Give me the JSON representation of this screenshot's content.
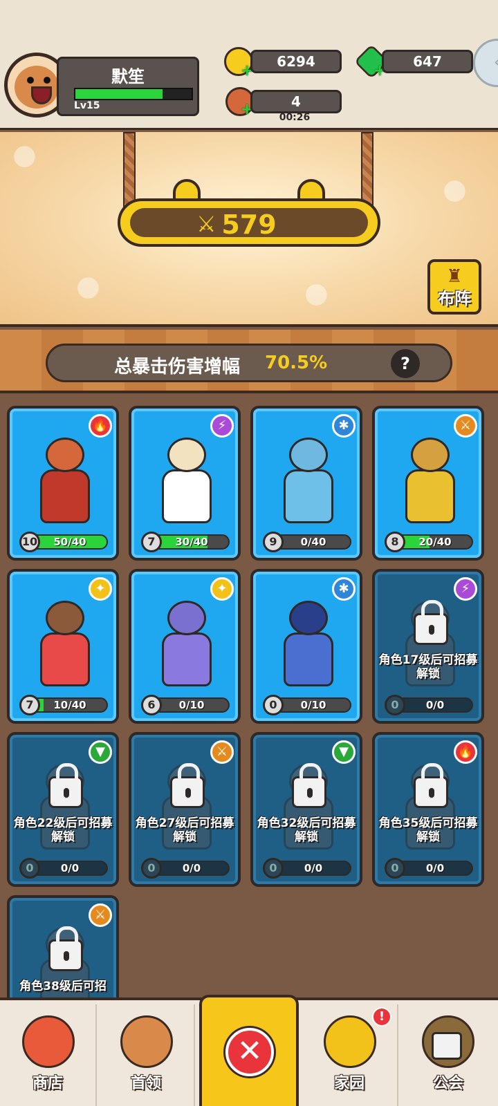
{
  "player": {
    "name": "默笙",
    "level": "Lv15",
    "xp_fraction": 0.75
  },
  "resources": {
    "gold": "6294",
    "gems": "647",
    "energy": "4",
    "energy_timer": "00:26"
  },
  "power": {
    "value": "579"
  },
  "formation": {
    "label": "布阵"
  },
  "crit": {
    "label": "总暴击伤害增幅",
    "value": "70.5%",
    "help": "?"
  },
  "heroes": [
    {
      "element": "fire",
      "level": "10",
      "progress": "50/40",
      "fill": 1.0,
      "locked": false
    },
    {
      "element": "lightning",
      "level": "7",
      "progress": "30/40",
      "fill": 0.75,
      "locked": false
    },
    {
      "element": "ice",
      "level": "9",
      "progress": "0/40",
      "fill": 0.0,
      "locked": false
    },
    {
      "element": "sword",
      "level": "8",
      "progress": "20/40",
      "fill": 0.5,
      "locked": false
    },
    {
      "element": "light",
      "level": "7",
      "progress": "10/40",
      "fill": 0.25,
      "locked": false
    },
    {
      "element": "light",
      "level": "6",
      "progress": "0/10",
      "fill": 0.0,
      "locked": false
    },
    {
      "element": "ice",
      "level": "0",
      "progress": "0/10",
      "fill": 0.0,
      "locked": false
    },
    {
      "element": "lightning",
      "level": "0",
      "progress": "0/0",
      "fill": 0.0,
      "locked": true,
      "lock_text": "角色17级后可招募解锁"
    },
    {
      "element": "wind",
      "level": "0",
      "progress": "0/0",
      "fill": 0.0,
      "locked": true,
      "lock_text": "角色22级后可招募解锁"
    },
    {
      "element": "sword",
      "level": "0",
      "progress": "0/0",
      "fill": 0.0,
      "locked": true,
      "lock_text": "角色27级后可招募解锁"
    },
    {
      "element": "wind",
      "level": "0",
      "progress": "0/0",
      "fill": 0.0,
      "locked": true,
      "lock_text": "角色32级后可招募解锁"
    },
    {
      "element": "fire",
      "level": "0",
      "progress": "0/0",
      "fill": 0.0,
      "locked": true,
      "lock_text": "角色35级后可招募解锁"
    },
    {
      "element": "sword",
      "level": "",
      "progress": "",
      "fill": 0.0,
      "locked": true,
      "lock_text": "角色38级后可招"
    }
  ],
  "nav": {
    "shop": "商店",
    "leader": "首领",
    "home": "家园",
    "guild": "公会",
    "close": "✕",
    "home_alert": "!"
  },
  "colors": {
    "fire": "#e8343a",
    "lightning": "#a94bd6",
    "ice": "#2f86d8",
    "sword": "#e58a1f",
    "light": "#f2c21a",
    "wind": "#2aa83a"
  }
}
